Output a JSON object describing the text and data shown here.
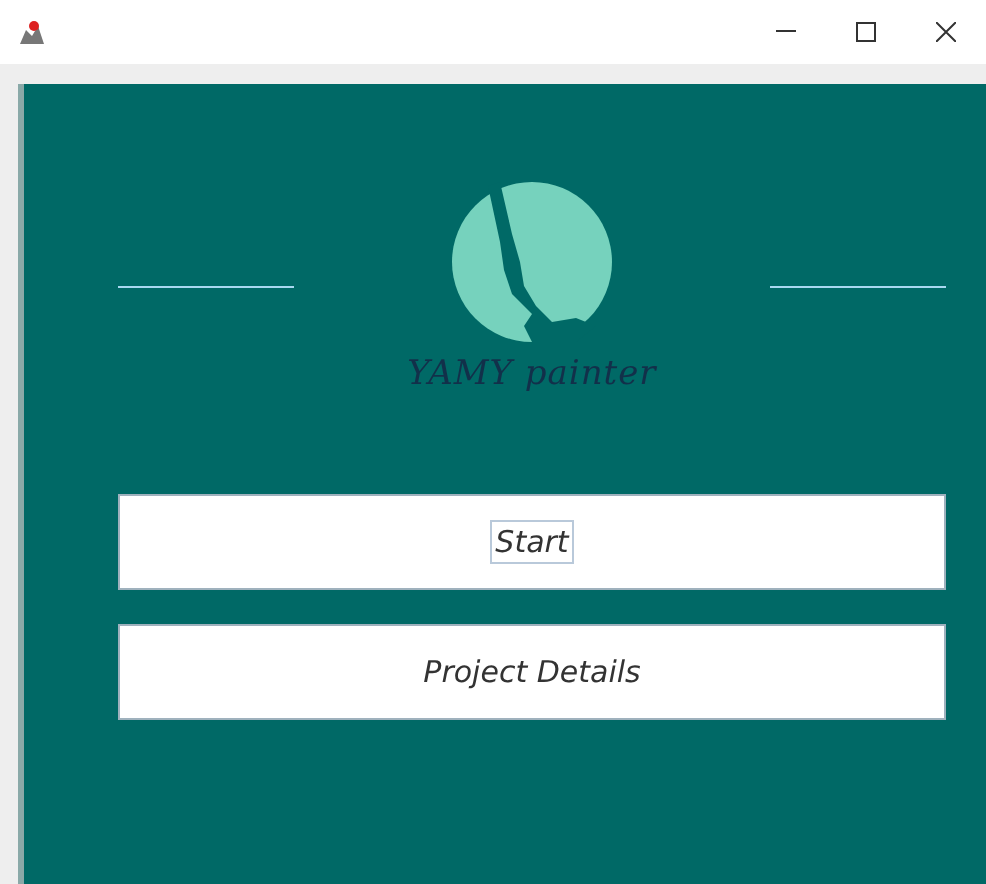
{
  "logo": {
    "text": "YAMY painter"
  },
  "buttons": [
    {
      "label": "Start",
      "focused": true
    },
    {
      "label": "Project Details",
      "focused": false
    }
  ]
}
